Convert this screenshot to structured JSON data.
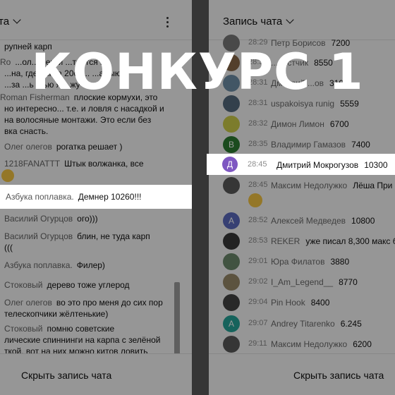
{
  "banner": {
    "text": "КОНКУРС 1"
  },
  "left_panel": {
    "title": "ата",
    "hide_label": "Скрыть запись чата",
    "messages": [
      {
        "author": "",
        "text": "рупней карп"
      },
      {
        "author": "Ro",
        "text": "...ол.. ...ерги ...тается в"
      },
      {
        "author": "",
        "text": "...на, где бы за 20се... ...алыю"
      },
      {
        "author": "",
        "text": "...за ...ь ...ью я ...жу"
      },
      {
        "author": "Roman Fisherman",
        "text": "плоские кормухи, это"
      },
      {
        "author": "",
        "text": "но интересно... т.е. и ловля с насадкой и"
      },
      {
        "author": "",
        "text": "на волосяные монтажи. Это если без"
      },
      {
        "author": "",
        "text": "вка снасть."
      },
      {
        "author": "Олег олегов",
        "text": "рогатка решает )"
      },
      {
        "author": "1218FANATTT",
        "text": "Штык волжанка, все"
      },
      {
        "author": "Василий Огурцов",
        "text": "ого)))"
      },
      {
        "author": "Василий Огурцов",
        "text": "блин, не туда карп"
      },
      {
        "author": "",
        "text": "((("
      },
      {
        "author": "Азбука поплавка.",
        "text": "Филер)"
      },
      {
        "author": "Стоковый",
        "text": "дерево тоже углерод"
      },
      {
        "author": "Олег олегов",
        "text": "во это про меня до сих пор"
      },
      {
        "author": "",
        "text": "телескопчики жёлтенькие)"
      },
      {
        "author": "Стоковый",
        "text": "помню советские"
      },
      {
        "author": "",
        "text": "лические спиннинги на карпа с зелёной"
      },
      {
        "author": "",
        "text": "ткой, вот на них можно китов ловить"
      }
    ],
    "highlight": {
      "author": "Азбука поплавка.",
      "text": "Демнер 10260!!!"
    }
  },
  "right_panel": {
    "title": "Запись чата",
    "hide_label": "Скрыть запись чата",
    "rows": [
      {
        "time": "28:29",
        "name": "Петр Борисов",
        "msg": "7200",
        "initial": "",
        "color": "#7a7a7a"
      },
      {
        "time": "28:30",
        "name": "...оистчик",
        "msg": "8550",
        "initial": "",
        "color": "#8a6a4a"
      },
      {
        "time": "28:31",
        "name": "Дмитрий ...ов",
        "msg": "3100",
        "initial": "",
        "color": "#6e8fa8"
      },
      {
        "time": "28:31",
        "name": "uspakoisya runig",
        "msg": "5559",
        "initial": "",
        "color": "#556b7f"
      },
      {
        "time": "28:32",
        "name": "Димон Лимон",
        "msg": "6700",
        "initial": "",
        "color": "#cfcf4a"
      },
      {
        "time": "28:35",
        "name": "Владимир Гамазов",
        "msg": "7400",
        "initial": "В",
        "color": "#2e7d32"
      },
      {
        "time": "28:45",
        "name": "Максим Недолужко",
        "msg": "Лёша При",
        "initial": "",
        "color": "#5a5a5a"
      },
      {
        "time": "28:52",
        "name": "Алексей Медведев",
        "msg": "10800",
        "initial": "А",
        "color": "#5c6bc0"
      },
      {
        "time": "28:53",
        "name": "REKER",
        "msg": "уже писал 8,300 макс бу",
        "initial": "",
        "color": "#3a3a3a"
      },
      {
        "time": "29:01",
        "name": "Юра Филатов",
        "msg": "3880",
        "initial": "",
        "color": "#6d8a6d"
      },
      {
        "time": "29:02",
        "name": "I_Am_Legend__",
        "msg": "8770",
        "initial": "",
        "color": "#9a8a6a"
      },
      {
        "time": "29:04",
        "name": "Pin Hook",
        "msg": "8400",
        "initial": "",
        "color": "#444444"
      },
      {
        "time": "29:07",
        "name": "Andrey Titarenko",
        "msg": "6.245",
        "initial": "A",
        "color": "#26a69a"
      },
      {
        "time": "29:11",
        "name": "Максим Недолужко",
        "msg": "6200",
        "initial": "",
        "color": "#5a5a5a"
      }
    ],
    "highlight": {
      "time": "28:45",
      "name": "Дмитрий Мокрогузов",
      "msg": "10300",
      "initial": "Д",
      "color": "#7e57c2"
    }
  }
}
